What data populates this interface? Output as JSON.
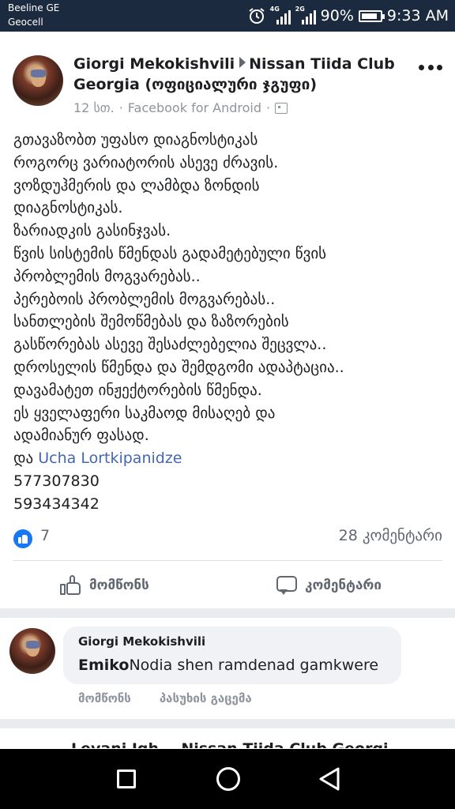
{
  "status_bar": {
    "carrier_1": "Beeline GE",
    "carrier_2": "Geocell",
    "network_1": "4G",
    "network_2": "2G",
    "battery": "90%",
    "battery_level": 0.9,
    "time": "9:33 AM",
    "icons": [
      "alarm-icon",
      "signal-4g-icon",
      "signal-2g-icon",
      "battery-icon"
    ]
  },
  "post": {
    "author": "Giorgi Mekokishvili",
    "group": "Nissan Tiida Club Georgia (ოფიციალური ჯგუფი)",
    "time": "12 სთ.",
    "source": "Facebook for Android",
    "lines": [
      "გთავაზობთ უფასო დიაგნოსტიკას",
      "როგორც ვარიატორის ასევე ძრავის.",
      "ვოზდუჰმერის და ლამბდა ზონდის",
      "დიაგნოსტიკას.",
      "ზარიადკის გასინჯვას.",
      "წვის სისტემის წმენდას გადამეტებული წვის",
      "პრობლემის მოგვარებას..",
      "პერებოის პრობლემის მოგვარებას..",
      "სანთლების შემოწმებას და ზაზორების",
      "გასწორებას ასევე შესაძლებელია შეცვლა..",
      "დროსელის წმენდა და შემდგომი ადაპტაცია..",
      "დავამატეთ ინჟექტორების წმენდა.",
      "ეს ყველაფერი საკმაოდ მისაღებ და",
      "ადამიანურ ფასად."
    ],
    "mention_prefix": "და",
    "mention": "Ucha Lortkipanidze",
    "phone_1": "577307830",
    "phone_2": "593434342",
    "like_count": "7",
    "comment_count": "28 კომენტარი",
    "like_label": "მომწონს",
    "comment_label": "კომენტარი"
  },
  "comment": {
    "author": "Giorgi Mekokishvili",
    "tag": "Emiko",
    "text": "Nodia shen ramdenad gamkwere",
    "like_label": "მომწონს",
    "reply_label": "პასუხის გაცემა"
  },
  "next_post": {
    "title": "Levani Jgh... Nissan Tiida Club Georgi"
  },
  "colors": {
    "status_bar": "#1c2a3f",
    "link": "#4267b2",
    "like_blue": "#1877f2"
  }
}
